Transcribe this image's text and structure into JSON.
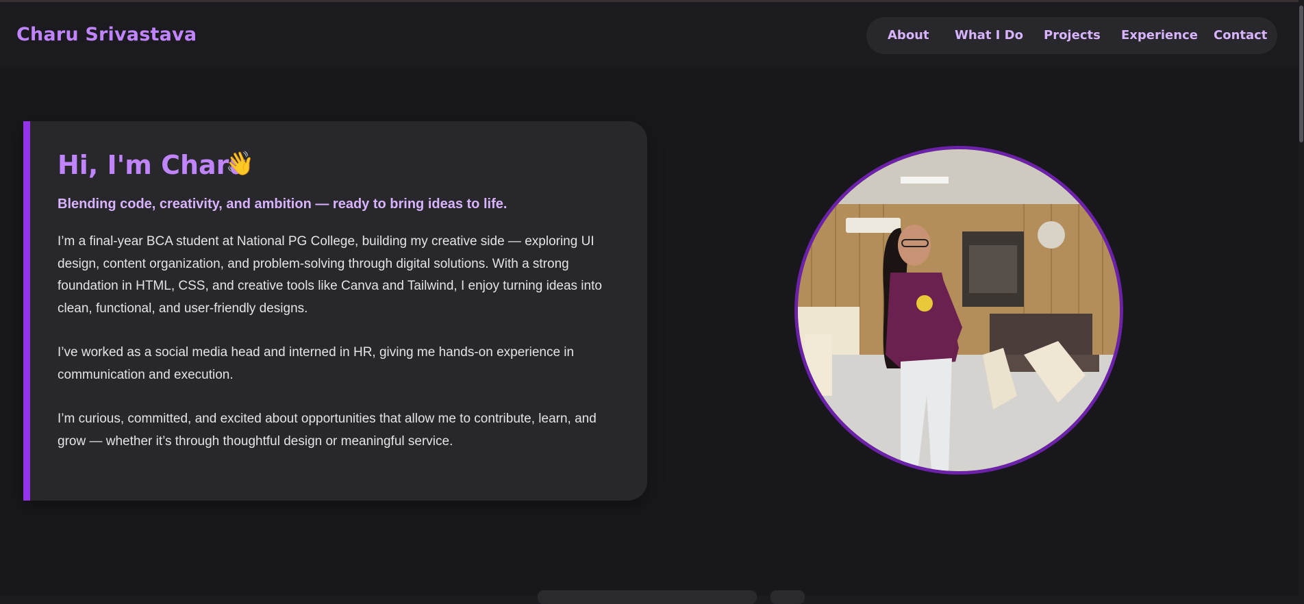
{
  "brand": "Charu Srivastava",
  "nav": {
    "items": [
      "About",
      "What I Do",
      "Projects",
      "Experience",
      "Contact"
    ]
  },
  "hero": {
    "greeting": "Hi, I'm Charu",
    "wave_emoji": "👋",
    "tagline": "Blending code, creativity, and ambition — ready to bring ideas to life.",
    "paragraphs": [
      "I’m a final-year BCA student at National PG College, building my creative side — exploring UI design, content organization, and problem-solving through digital solutions. With a strong foundation in HTML, CSS, and creative tools like Canva and Tailwind, I enjoy turning ideas into clean, functional, and user-friendly designs.",
      "I’ve worked as a social media head and interned in HR, giving me hands-on experience in communication and execution.",
      "I’m curious, committed, and excited about opportunities that allow me to contribute, learn, and grow — whether it’s through thoughtful design or meaningful service."
    ]
  },
  "colors": {
    "accent": "#9333ea",
    "brand": "#c084fc",
    "nav_text": "#d8b4fe",
    "background": "#18171b",
    "card": "#28272b"
  }
}
